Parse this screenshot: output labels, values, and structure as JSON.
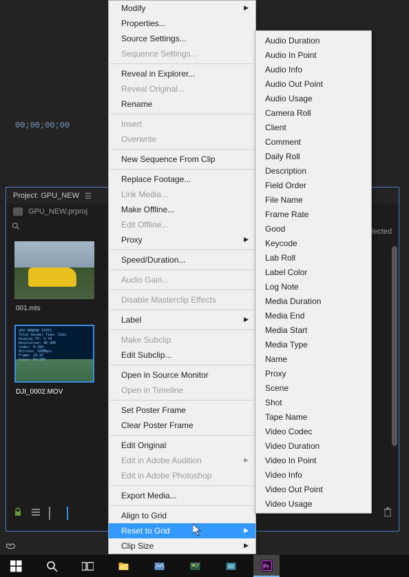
{
  "preview": {
    "timecode": "00;00;00;00"
  },
  "project": {
    "title": "Project: GPU_NEW",
    "file": "GPU_NEW.prproj",
    "selected_text": "elected",
    "thumbs": [
      {
        "label": "001.mts"
      },
      {
        "label": "DJI_0002.MOV"
      }
    ]
  },
  "context_menu": [
    {
      "label": "Modify",
      "enabled": true,
      "arrow": true
    },
    {
      "label": "Properties...",
      "enabled": true
    },
    {
      "label": "Source Settings...",
      "enabled": true
    },
    {
      "label": "Sequence Settings...",
      "enabled": false
    },
    {
      "sep": true
    },
    {
      "label": "Reveal in Explorer...",
      "enabled": true
    },
    {
      "label": "Reveal Original...",
      "enabled": false
    },
    {
      "label": "Rename",
      "enabled": true
    },
    {
      "sep": true
    },
    {
      "label": "Insert",
      "enabled": false
    },
    {
      "label": "Overwrite",
      "enabled": false
    },
    {
      "sep": true
    },
    {
      "label": "New Sequence From Clip",
      "enabled": true
    },
    {
      "sep": true
    },
    {
      "label": "Replace Footage...",
      "enabled": true
    },
    {
      "label": "Link Media...",
      "enabled": false
    },
    {
      "label": "Make Offline...",
      "enabled": true
    },
    {
      "label": "Edit Offline...",
      "enabled": false
    },
    {
      "label": "Proxy",
      "enabled": true,
      "arrow": true
    },
    {
      "sep": true
    },
    {
      "label": "Speed/Duration...",
      "enabled": true
    },
    {
      "sep": true
    },
    {
      "label": "Audio Gain...",
      "enabled": false
    },
    {
      "sep": true
    },
    {
      "label": "Disable Masterclip Effects",
      "enabled": false
    },
    {
      "sep": true
    },
    {
      "label": "Label",
      "enabled": true,
      "arrow": true
    },
    {
      "sep": true
    },
    {
      "label": "Make Subclip",
      "enabled": false
    },
    {
      "label": "Edit Subclip...",
      "enabled": true
    },
    {
      "sep": true
    },
    {
      "label": "Open in Source Monitor",
      "enabled": true
    },
    {
      "label": "Open in Timeline",
      "enabled": false
    },
    {
      "sep": true
    },
    {
      "label": "Set Poster Frame",
      "enabled": true
    },
    {
      "label": "Clear Poster Frame",
      "enabled": true
    },
    {
      "sep": true
    },
    {
      "label": "Edit Original",
      "enabled": true
    },
    {
      "label": "Edit in Adobe Audition",
      "enabled": false,
      "arrow": true
    },
    {
      "label": "Edit in Adobe Photoshop",
      "enabled": false
    },
    {
      "sep": true
    },
    {
      "label": "Export Media...",
      "enabled": true
    },
    {
      "sep": true
    },
    {
      "label": "Align to Grid",
      "enabled": true
    },
    {
      "label": "Reset to Grid",
      "enabled": true,
      "arrow": true,
      "highlighted": true
    },
    {
      "label": "Clip Size",
      "enabled": true,
      "arrow": true
    }
  ],
  "submenu": [
    "Audio Duration",
    "Audio In Point",
    "Audio Info",
    "Audio Out Point",
    "Audio Usage",
    "Camera Roll",
    "Client",
    "Comment",
    "Daily Roll",
    "Description",
    "Field Order",
    "File Name",
    "Frame Rate",
    "Good",
    "Keycode",
    "Lab Roll",
    "Label Color",
    "Log Note",
    "Media Duration",
    "Media End",
    "Media Start",
    "Media Type",
    "Name",
    "Proxy",
    "Scene",
    "Shot",
    "Tape Name",
    "Video Codec",
    "Video Duration",
    "Video In Point",
    "Video Info",
    "Video Out Point",
    "Video Usage"
  ]
}
